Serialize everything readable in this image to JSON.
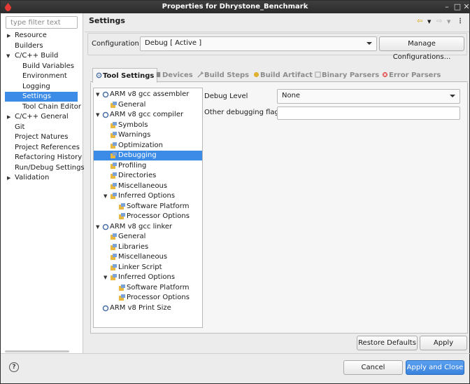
{
  "window": {
    "title": "Properties for Dhrystone_Benchmark"
  },
  "sidebar": {
    "filter_placeholder": "type filter text",
    "items": [
      {
        "label": "Resource"
      },
      {
        "label": "Builders"
      },
      {
        "label": "C/C++ Build"
      },
      {
        "label": "Build Variables"
      },
      {
        "label": "Environment"
      },
      {
        "label": "Logging"
      },
      {
        "label": "Settings"
      },
      {
        "label": "Tool Chain Editor"
      },
      {
        "label": "C/C++ General"
      },
      {
        "label": "Git"
      },
      {
        "label": "Project Natures"
      },
      {
        "label": "Project References"
      },
      {
        "label": "Refactoring History"
      },
      {
        "label": "Run/Debug Settings"
      },
      {
        "label": "Validation"
      }
    ]
  },
  "main": {
    "heading": "Settings",
    "configuration": {
      "label": "Configuration:",
      "value": "Debug  [ Active ]",
      "manage_button": "Manage Configurations..."
    },
    "tabs": [
      {
        "label": "Tool Settings"
      },
      {
        "label": "Devices"
      },
      {
        "label": "Build Steps"
      },
      {
        "label": "Build Artifact"
      },
      {
        "label": "Binary Parsers"
      },
      {
        "label": "Error Parsers"
      }
    ],
    "tree": [
      {
        "label": "ARM v8 gcc assembler"
      },
      {
        "label": "General"
      },
      {
        "label": "ARM v8 gcc compiler"
      },
      {
        "label": "Symbols"
      },
      {
        "label": "Warnings"
      },
      {
        "label": "Optimization"
      },
      {
        "label": "Debugging"
      },
      {
        "label": "Profiling"
      },
      {
        "label": "Directories"
      },
      {
        "label": "Miscellaneous"
      },
      {
        "label": "Inferred Options"
      },
      {
        "label": "Software Platform"
      },
      {
        "label": "Processor Options"
      },
      {
        "label": "ARM v8 gcc linker"
      },
      {
        "label": "General"
      },
      {
        "label": "Libraries"
      },
      {
        "label": "Miscellaneous"
      },
      {
        "label": "Linker Script"
      },
      {
        "label": "Inferred Options"
      },
      {
        "label": "Software Platform"
      },
      {
        "label": "Processor Options"
      },
      {
        "label": "ARM v8 Print Size"
      }
    ],
    "debug_level": {
      "label": "Debug Level",
      "value": "None"
    },
    "other_flags": {
      "label": "Other debugging flags",
      "value": ""
    }
  },
  "buttons": {
    "restore_defaults": "Restore Defaults",
    "apply": "Apply",
    "cancel": "Cancel",
    "apply_and_close": "Apply and Close"
  },
  "colors": {
    "selection": "#3c8ce7",
    "primary_button": "#3a83de",
    "titlebar": "#2b2b2b"
  }
}
